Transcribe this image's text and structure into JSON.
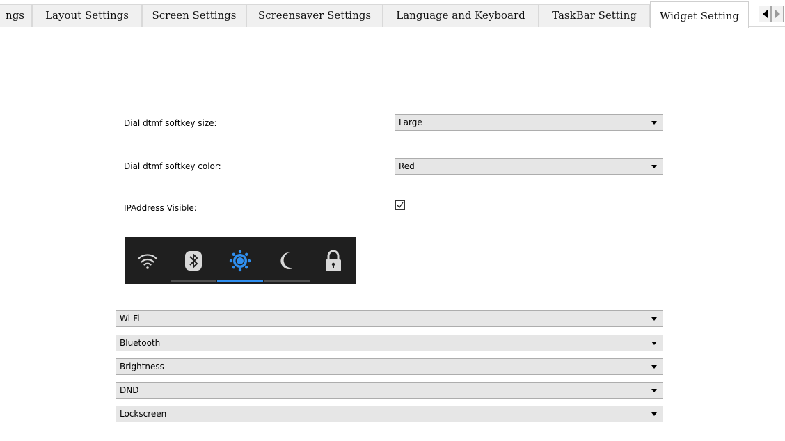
{
  "tabs": [
    {
      "label": "ngs",
      "active": false
    },
    {
      "label": "Layout Settings",
      "active": false
    },
    {
      "label": "Screen Settings",
      "active": false
    },
    {
      "label": "Screensaver Settings",
      "active": false
    },
    {
      "label": "Language and Keyboard",
      "active": false
    },
    {
      "label": "TaskBar Setting",
      "active": false
    },
    {
      "label": "Widget Setting",
      "active": true
    }
  ],
  "tab_scroll": {
    "left_icon": "triangle-left-icon",
    "right_icon": "triangle-right-icon"
  },
  "settings": {
    "dtmf_size": {
      "label": "Dial dtmf softkey size:",
      "value": "Large"
    },
    "dtmf_color": {
      "label": "Dial dtmf softkey color:",
      "value": "Red"
    },
    "ip_visible": {
      "label": "IPAddress Visible:",
      "checked": true
    }
  },
  "preview": {
    "icons": [
      "wifi-icon",
      "bluetooth-icon",
      "brightness-icon",
      "moon-icon",
      "lock-icon"
    ],
    "highlight_color": "#2f8ff0",
    "background_color": "#1f1f1f"
  },
  "widget_slots": [
    {
      "value": "Wi-Fi"
    },
    {
      "value": "Bluetooth"
    },
    {
      "value": "Brightness"
    },
    {
      "value": "DND"
    },
    {
      "value": "Lockscreen"
    }
  ],
  "colors": {
    "combo_bg": "#e6e6e6",
    "tab_bg": "#f0f0f0",
    "active_tab_bg": "#ffffff"
  }
}
